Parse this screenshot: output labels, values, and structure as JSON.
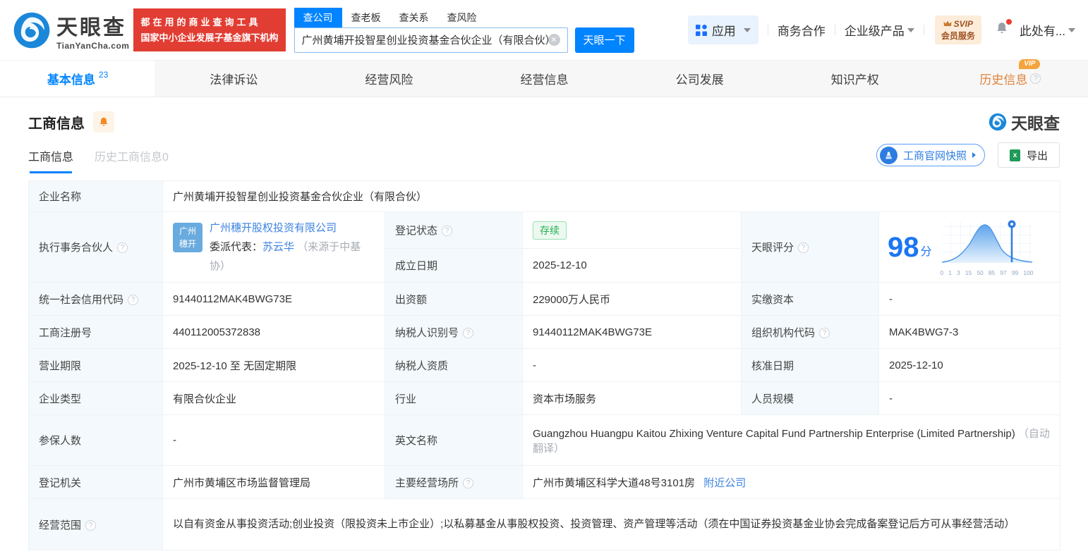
{
  "colors": {
    "primary_blue": "#0084ff",
    "link_blue": "#3e83e0",
    "slogan_red": "#e23d33",
    "status_green": "#27ae4f",
    "history_orange": "#e0823a",
    "score_blue": "#1b76f2"
  },
  "header": {
    "brand": "天眼查",
    "brand_domain": "TianYanCha.com",
    "slogan_line1": "都在用的商业查询工具",
    "slogan_line2": "国家中小企业发展子基金旗下机构",
    "search_tabs": [
      {
        "label": "查公司"
      },
      {
        "label": "查老板"
      },
      {
        "label": "查关系"
      },
      {
        "label": "查风险"
      }
    ],
    "search": {
      "value": "广州黄埔开投智星创业投资基金合伙企业（有限合伙）",
      "button": "天眼一下"
    },
    "nav": {
      "apps": "应用",
      "cooperation": "商务合作",
      "enterprise": "企业级产品",
      "svip_line1": "SVIP",
      "svip_line2": "会员服务",
      "user": "此处有..."
    }
  },
  "main_tabs": [
    {
      "label": "基本信息",
      "count": "23"
    },
    {
      "label": "法律诉讼"
    },
    {
      "label": "经营风险"
    },
    {
      "label": "经营信息"
    },
    {
      "label": "公司发展"
    },
    {
      "label": "知识产权"
    },
    {
      "label": "历史信息",
      "vip": "VIP"
    }
  ],
  "section": {
    "title": "工商信息",
    "watermark": "天眼查",
    "subtabs": [
      {
        "label": "工商信息"
      },
      {
        "label": "历史工商信息0"
      }
    ],
    "snapshot_button": "工商官网快照",
    "export_button": "导出"
  },
  "table": {
    "company_name": {
      "label": "企业名称",
      "value": "广州黄埔开投智星创业投资基金合伙企业（有限合伙）"
    },
    "partner": {
      "label": "执行事务合伙人",
      "avatar_line1": "广州",
      "avatar_line2": "穗开",
      "company": "广州穗开股权投资有限公司",
      "rep_label": "委派代表：",
      "rep_name": "苏云华",
      "rep_source": "（来源于中基协）"
    },
    "reg_status": {
      "label": "登记状态",
      "value": "存续"
    },
    "est_date": {
      "label": "成立日期",
      "value": "2025-12-10"
    },
    "score": {
      "label": "天眼评分",
      "value": "98",
      "unit": "分",
      "axis": [
        "0",
        "1",
        "3",
        "15",
        "50",
        "85",
        "97",
        "99",
        "100"
      ]
    },
    "credit_code": {
      "label": "统一社会信用代码",
      "value": "91440112MAK4BWG73E"
    },
    "capital": {
      "label": "出资额",
      "value": "229000万人民币"
    },
    "paid_capital": {
      "label": "实缴资本",
      "value": "-"
    },
    "reg_number": {
      "label": "工商注册号",
      "value": "440112005372838"
    },
    "taxpayer_id": {
      "label": "纳税人识别号",
      "value": "91440112MAK4BWG73E"
    },
    "org_code": {
      "label": "组织机构代码",
      "value": "MAK4BWG7-3"
    },
    "business_term": {
      "label": "营业期限",
      "value": "2025-12-10 至 无固定期限"
    },
    "taxpayer_quality": {
      "label": "纳税人资质",
      "value": "-"
    },
    "approval_date": {
      "label": "核准日期",
      "value": "2025-12-10"
    },
    "company_type": {
      "label": "企业类型",
      "value": "有限合伙企业"
    },
    "industry": {
      "label": "行业",
      "value": "资本市场服务"
    },
    "staff_size": {
      "label": "人员规模",
      "value": "-"
    },
    "insured_count": {
      "label": "参保人数",
      "value": "-"
    },
    "english_name": {
      "label": "英文名称",
      "value": "Guangzhou Huangpu Kaitou Zhixing Venture Capital Fund Partnership Enterprise (Limited Partnership)",
      "note": "（自动翻译）"
    },
    "reg_authority": {
      "label": "登记机关",
      "value": "广州市黄埔区市场监督管理局"
    },
    "premises": {
      "label": "主要经营场所",
      "value": "广州市黄埔区科学大道48号3101房",
      "link": "附近公司"
    },
    "business_scope": {
      "label": "经营范围",
      "value": "以自有资金从事投资活动;创业投资（限投资未上市企业）;以私募基金从事股权投资、投资管理、资产管理等活动（须在中国证券投资基金业协会完成备案登记后方可从事经营活动）"
    }
  }
}
